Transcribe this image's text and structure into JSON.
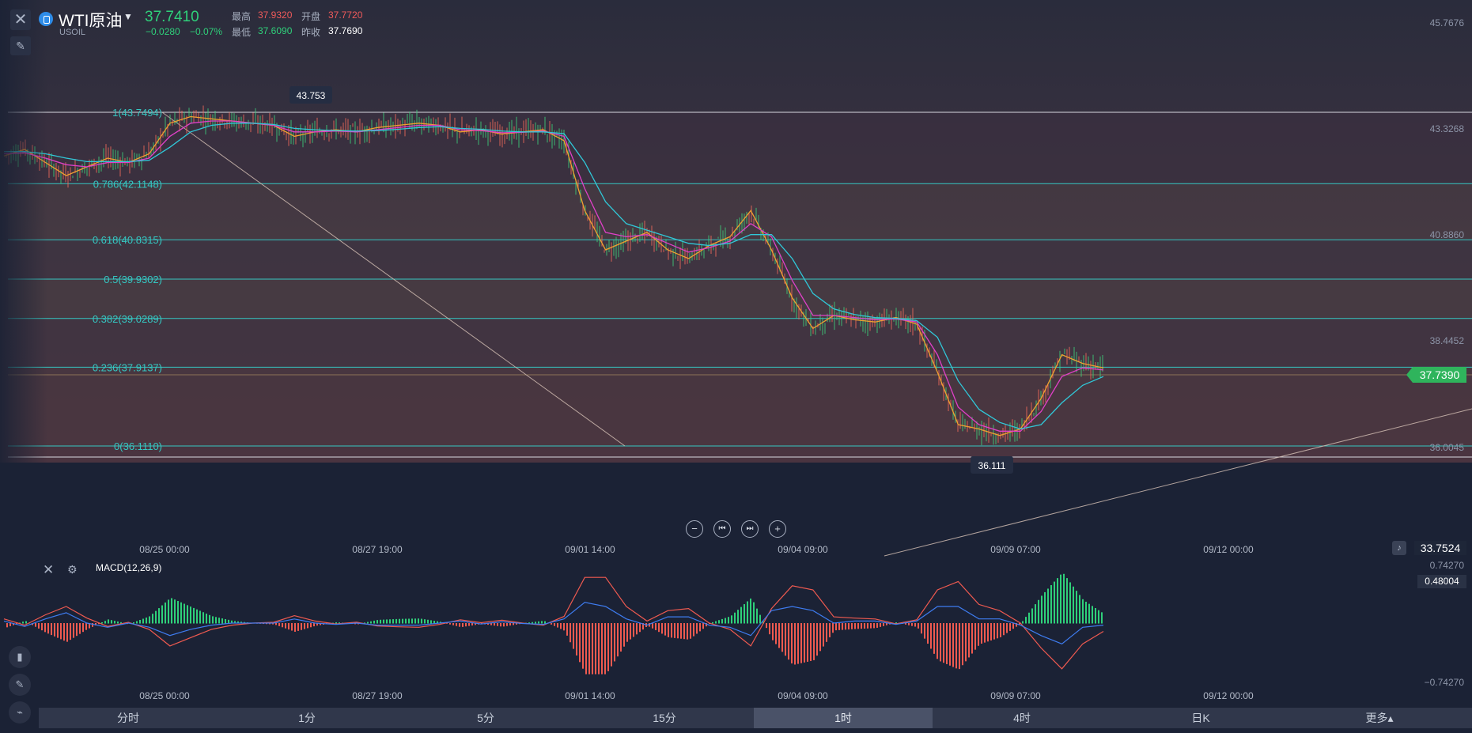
{
  "header": {
    "name": "WTI原油",
    "code": "USOIL",
    "last": "37.7410",
    "change": "−0.0280",
    "change_pct": "−0.07%",
    "high_label": "最高",
    "high": "37.9320",
    "open_label": "开盘",
    "open": "37.7720",
    "low_label": "最低",
    "low": "37.6090",
    "prev_label": "昨收",
    "prev": "37.7690"
  },
  "icons": {
    "close": "close-icon",
    "draw_tool": "pencil-icon",
    "nav": [
      "zoom-out-icon",
      "skip-back-icon",
      "skip-forward-icon",
      "zoom-in-icon"
    ],
    "side": [
      "bar-chart-icon",
      "pencil-icon",
      "indicator-icon"
    ],
    "bell": "bell-icon"
  },
  "fibonacci": [
    {
      "label": "1(43.7494)",
      "price": 43.7494
    },
    {
      "label": "0.786(42.1148)",
      "price": 42.1148
    },
    {
      "label": "0.618(40.8315)",
      "price": 40.8315
    },
    {
      "label": "0.5(39.9302)",
      "price": 39.9302
    },
    {
      "label": "0.382(39.0289)",
      "price": 39.0289
    },
    {
      "label": "0.236(37.9137)",
      "price": 37.9137
    },
    {
      "label": "0(36.1110)",
      "price": 36.111
    }
  ],
  "markers": {
    "high": "43.753",
    "low": "36.111"
  },
  "price_axis": [
    "45.7676",
    "43.3268",
    "40.8860",
    "38.4452",
    "36.0045"
  ],
  "current_price_tag": "37.7390",
  "cursor_price_tag": "33.7524",
  "time_axis": [
    "08/25 00:00",
    "08/27 19:00",
    "09/01 14:00",
    "09/04 09:00",
    "09/09 07:00",
    "09/12 00:00"
  ],
  "macd": {
    "label": "MACD(12,26,9)",
    "axis_top": "0.74270",
    "axis_bottom": "−0.74270",
    "current": "0.48004"
  },
  "tabs": [
    {
      "label": "分时"
    },
    {
      "label": "1分"
    },
    {
      "label": "5分"
    },
    {
      "label": "15分"
    },
    {
      "label": "1时",
      "active": true
    },
    {
      "label": "4时"
    },
    {
      "label": "日K"
    },
    {
      "label": "更多▴"
    }
  ],
  "colors": {
    "up": "#f05a5a",
    "down": "#2fd07a",
    "fib_line": "#35c7c2",
    "bg": "#1b2235"
  },
  "chart_data": {
    "type": "line",
    "title": "",
    "xlabel": "",
    "ylabel": "",
    "ylim": [
      35.7,
      45.9
    ],
    "x": [
      "08/25 00:00",
      "08/27 19:00",
      "09/01 14:00",
      "09/04 09:00",
      "09/09 07:00",
      "09/12 00:00"
    ],
    "series": [
      {
        "values": [
          42.75,
          42.9,
          42.6,
          42.3,
          42.5,
          42.7,
          42.6,
          42.8,
          43.5,
          43.65,
          43.6,
          43.55,
          43.5,
          43.45,
          43.2,
          43.3,
          43.35,
          43.3,
          43.4,
          43.45,
          43.5,
          43.45,
          43.3,
          43.35,
          43.25,
          43.3,
          43.35,
          43.1,
          41.5,
          40.6,
          40.8,
          41.0,
          40.6,
          40.4,
          40.7,
          40.9,
          41.5,
          40.6,
          39.5,
          38.8,
          39.1,
          39.0,
          38.95,
          39.05,
          38.9,
          37.8,
          36.6,
          36.5,
          36.35,
          36.5,
          37.2,
          38.2,
          38.0,
          37.9
        ]
      },
      {
        "values": [
          42.8,
          42.82,
          42.7,
          42.55,
          42.5,
          42.6,
          42.6,
          42.7,
          43.2,
          43.5,
          43.55,
          43.55,
          43.5,
          43.45,
          43.3,
          43.3,
          43.32,
          43.3,
          43.35,
          43.4,
          43.45,
          43.45,
          43.35,
          43.33,
          43.28,
          43.29,
          43.32,
          43.2,
          42.0,
          41.0,
          40.9,
          40.95,
          40.75,
          40.55,
          40.65,
          40.8,
          41.2,
          40.9,
          39.9,
          39.1,
          39.1,
          39.05,
          39.0,
          39.02,
          38.95,
          38.2,
          37.0,
          36.6,
          36.45,
          36.45,
          36.9,
          37.7,
          37.9,
          37.85
        ]
      },
      {
        "values": [
          42.85,
          42.85,
          42.8,
          42.7,
          42.62,
          42.62,
          42.62,
          42.65,
          42.95,
          43.3,
          43.45,
          43.5,
          43.5,
          43.47,
          43.38,
          43.35,
          43.33,
          43.32,
          43.33,
          43.36,
          43.4,
          43.42,
          43.38,
          43.36,
          43.32,
          43.3,
          43.3,
          43.26,
          42.6,
          41.7,
          41.2,
          41.05,
          40.9,
          40.75,
          40.7,
          40.75,
          40.95,
          40.95,
          40.4,
          39.6,
          39.25,
          39.12,
          39.05,
          39.03,
          38.98,
          38.6,
          37.6,
          36.95,
          36.65,
          36.5,
          36.6,
          37.1,
          37.5,
          37.7
        ]
      }
    ]
  }
}
